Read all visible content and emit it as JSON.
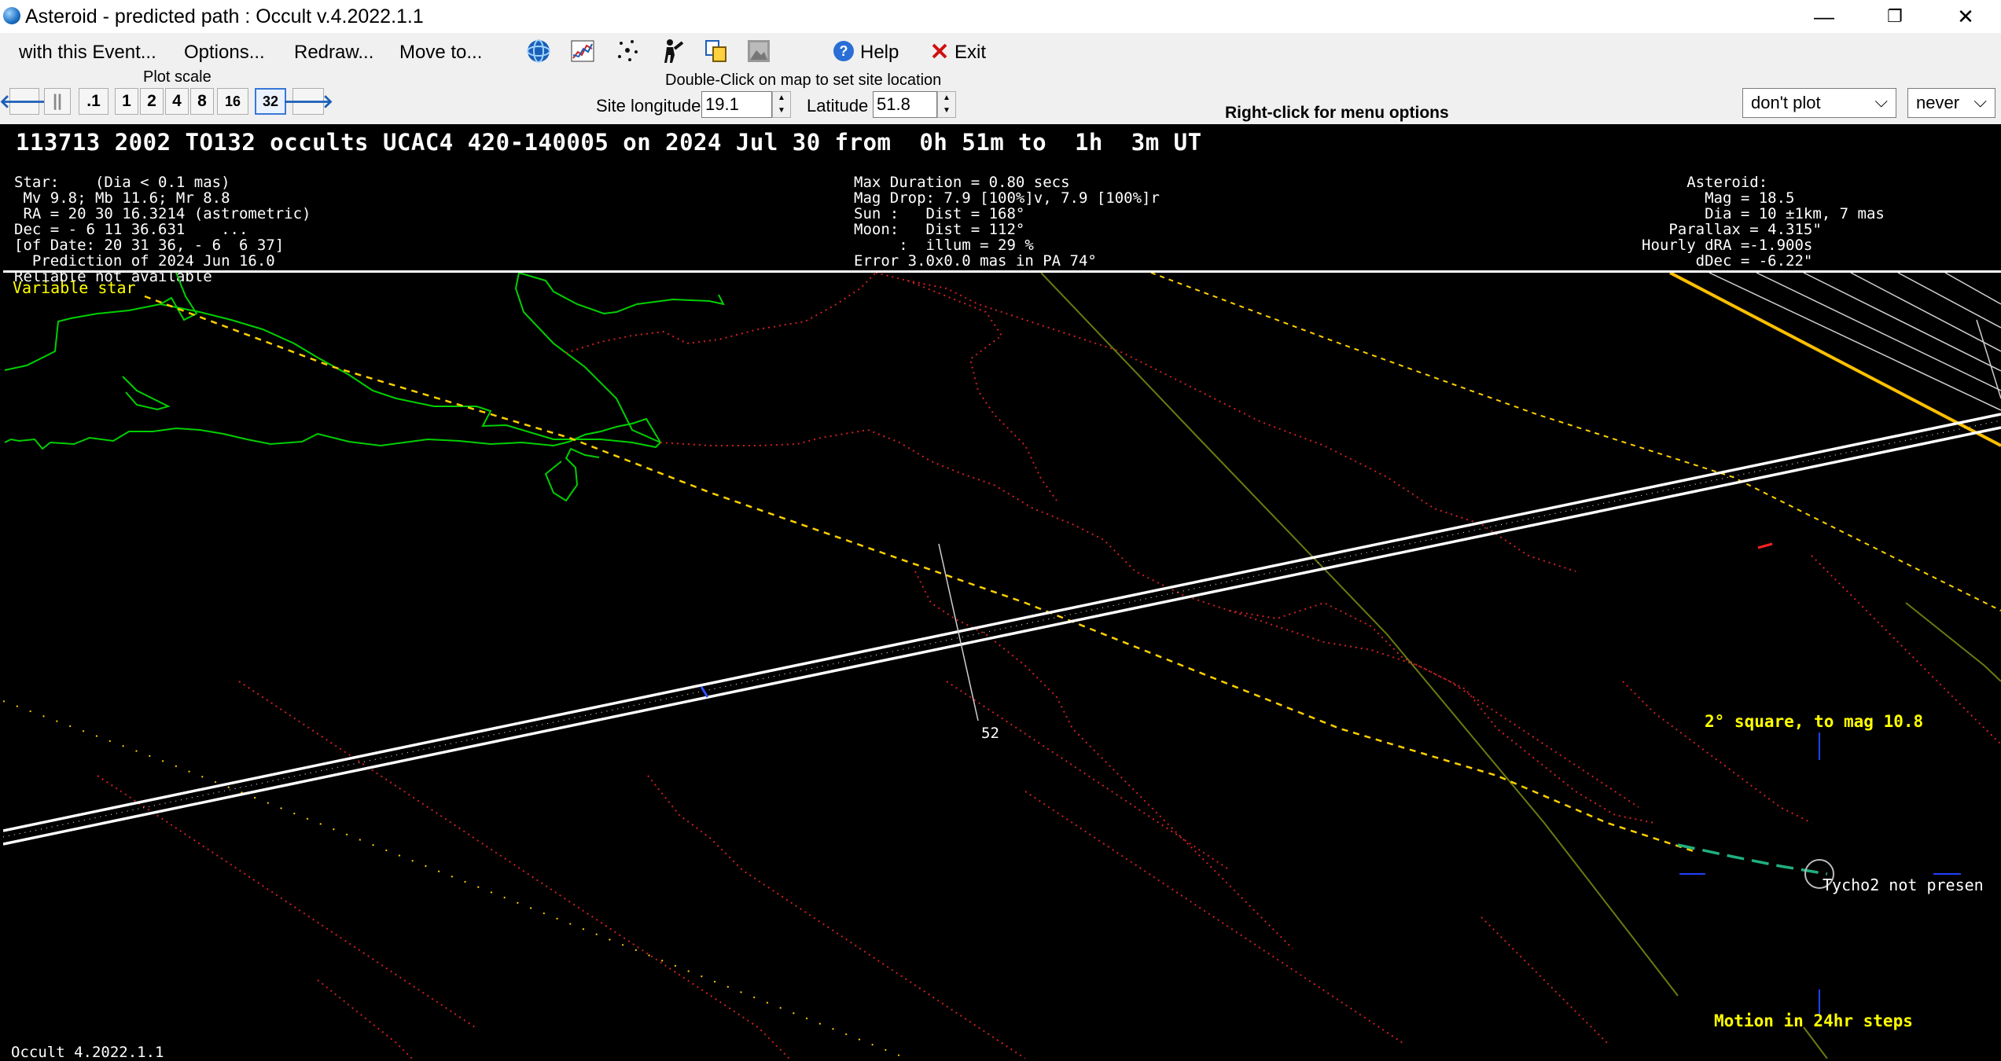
{
  "window": {
    "title": "Asteroid - predicted path : Occult v.4.2022.1.1",
    "minimize": "—",
    "restore": "❐",
    "close": "✕"
  },
  "menu": {
    "with_event": "with this Event...",
    "options": "Options...",
    "redraw": "Redraw...",
    "move_to": "Move to...",
    "help": "Help",
    "exit": "Exit"
  },
  "toolbar": {
    "plot_scale_label": "Plot scale",
    "left_arrow": "🡐",
    "pause": "||",
    "right_arrow": "🡒",
    "scales": [
      ".1",
      "1",
      "2",
      "4",
      "8",
      "16",
      "32"
    ],
    "active_scale": "32",
    "double_click_hint": "Double-Click on map to set site location",
    "site_longitude_label": "Site longitude",
    "site_longitude_value": "19.1",
    "latitude_label": "Latitude",
    "latitude_value": "51.8",
    "right_click_hint": "Right-click for menu options",
    "plot_combo_value": "don't plot",
    "never_combo_value": "never"
  },
  "event": {
    "headline": "113713 2002 TO132 occults UCAC4 420-140005 on 2024 Jul 30 from  0h 51m to  1h  3m UT",
    "star_lines": [
      "Star:    (Dia < 0.1 mas)",
      " Mv 9.8; Mb 11.6; Mr 8.8",
      " RA = 20 30 16.3214 (astrometric)",
      "Dec = - 6 11 36.631    ...",
      "[of Date: 20 31 36, - 6  6 37]",
      "  Prediction of 2024 Jun 16.0",
      "Reliable not available"
    ],
    "mid_lines": [
      "Max Duration = 0.80 secs",
      "Mag Drop: 7.9 [100%]v, 7.9 [100%]r",
      "Sun :   Dist = 168°",
      "Moon:   Dist = 112°",
      "     :  illum = 29 %",
      "Error 3.0x0.0 mas in PA 74°"
    ],
    "asteroid_lines": [
      "     Asteroid:",
      "       Mag = 18.5",
      "       Dia = 10 ±1km, 7 mas",
      "   Parallax = 4.315\"",
      "Hourly dRA =-1.900s",
      "      dDec = -6.22\""
    ]
  },
  "map": {
    "variable_star": "Variable star",
    "site_label": "52",
    "square_label": "2° square, to mag 10.8",
    "tycho_label": "Tycho2 not presen",
    "motion_label": "Motion in 24hr steps",
    "version_label": "Occult 4.2022.1.1",
    "colors": {
      "coast": "#00d000",
      "border": "#d02020",
      "path": "#ffffff",
      "yellow": "#ffd000",
      "label": "#ffff00",
      "green_line": "#6a7a10"
    }
  }
}
